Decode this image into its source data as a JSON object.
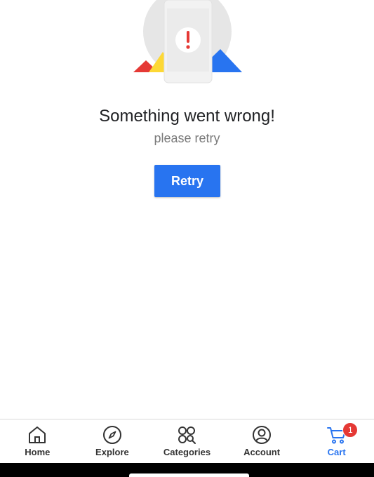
{
  "error": {
    "title": "Something went wrong!",
    "subtitle": "please retry",
    "retry_label": "Retry",
    "illustration_icon": "phone-error-icon",
    "colors": {
      "red": "#e53935",
      "yellow": "#fdd835",
      "blue": "#2874f0",
      "circle": "#e6e6e6"
    }
  },
  "bottom_nav": {
    "items": [
      {
        "label": "Home",
        "icon": "home-icon",
        "active": false
      },
      {
        "label": "Explore",
        "icon": "compass-icon",
        "active": false
      },
      {
        "label": "Categories",
        "icon": "categories-icon",
        "active": false
      },
      {
        "label": "Account",
        "icon": "account-icon",
        "active": false
      },
      {
        "label": "Cart",
        "icon": "cart-icon",
        "active": true,
        "badge": "1"
      }
    ],
    "active_color": "#2874f0"
  }
}
